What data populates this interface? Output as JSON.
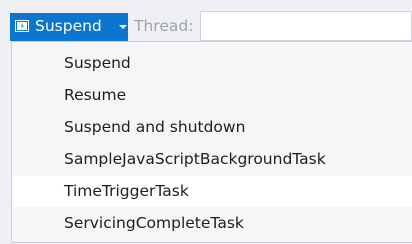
{
  "toolbar": {
    "suspend_label": "Suspend",
    "suspend_icon": "suspend-lifecycle-icon",
    "thread_label": "Thread:",
    "thread_value": ""
  },
  "menu": {
    "items": [
      {
        "label": "Suspend"
      },
      {
        "label": "Resume"
      },
      {
        "label": "Suspend and shutdown"
      },
      {
        "label": "SampleJavaScriptBackgroundTask"
      },
      {
        "label": "TimeTriggerTask",
        "hovered": true
      },
      {
        "label": "ServicingCompleteTask"
      }
    ]
  },
  "colors": {
    "accent": "#0b76d0",
    "menu_background": "#f6f6f8",
    "hover_background": "#ffffff"
  }
}
